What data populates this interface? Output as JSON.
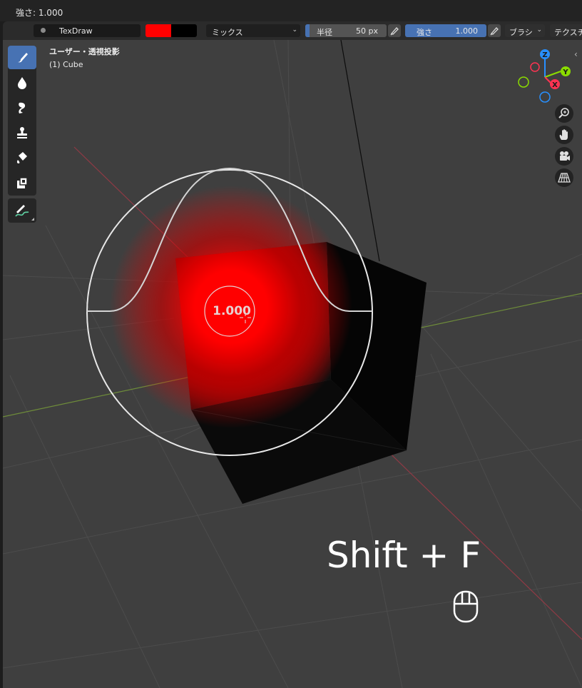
{
  "status_bar": {
    "text": "強さ: 1.000"
  },
  "header": {
    "brush_name": "TexDraw",
    "color_primary": "#ff0000",
    "color_secondary": "#000000",
    "blend_mode": "ミックス",
    "radius_label": "半径",
    "radius_value": "50 px",
    "strength_label": "強さ",
    "strength_value": "1.000",
    "brush_menu": "ブラシ",
    "texture_menu": "テクスチ"
  },
  "viewport": {
    "view_title": "ユーザー・透視投影",
    "object_name": "(1) Cube",
    "brush_readout": "1.000",
    "shortcut_overlay": "Shift + F"
  },
  "toolbar": {
    "tools": [
      "draw-icon",
      "soften-icon",
      "smear-icon",
      "clone-icon",
      "fill-icon",
      "mask-icon"
    ],
    "annotate": "annotate-icon"
  },
  "gizmo": {
    "axes": {
      "z": "Z",
      "y": "Y",
      "x": "X"
    },
    "colors": {
      "x": "#ff3352",
      "y": "#8bdc00",
      "z": "#2890ff"
    }
  },
  "navigation": [
    "zoom-icon",
    "pan-hand-icon",
    "camera-icon",
    "grid-perspective-icon"
  ],
  "colors": {
    "accent": "#4772b3",
    "brush_paint": "#ff0000"
  }
}
